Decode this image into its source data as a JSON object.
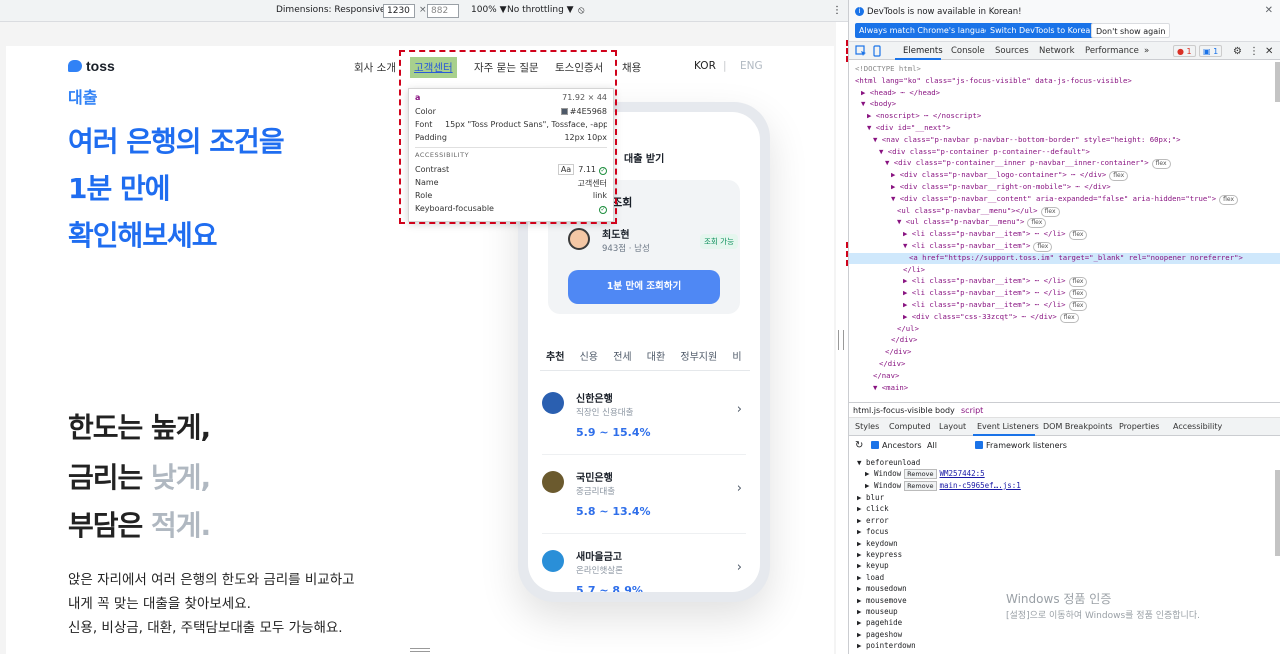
{
  "emulation": {
    "dimensions_label": "Dimensions: Responsive ▼",
    "width": "1230",
    "height": "882",
    "zoom": "100% ▼",
    "throttle": "No throttling ▼",
    "times": "×"
  },
  "site": {
    "logo_text": "toss",
    "nav": [
      "회사 소개",
      "고객센터",
      "자주 묻는 질문",
      "토스인증서",
      "채용"
    ],
    "lang_kor": "KOR",
    "lang_divider": "|",
    "lang_eng": "ENG",
    "hero_tag": "대출",
    "hero_lines": [
      "여러 은행의 조건을",
      "1분 만에",
      "확인해보세요"
    ],
    "feature_lines": [
      {
        "a": "한도는 높게,",
        "b": ""
      },
      {
        "a": "금리는 ",
        "b": "낮게,"
      },
      {
        "a": "부담은 ",
        "b": "적게."
      }
    ],
    "desc_lines": [
      "앉은 자리에서 여러 은행의 한도와 금리를 비교하고",
      "내게 꼭 맞는 대출을 찾아보세요.",
      "신용, 비상금, 대환, 주택담보대출 모두 가능해요."
    ]
  },
  "phone": {
    "title": "대출 받기",
    "card_title": "출조회",
    "user_name": "최도현",
    "user_sub": "943점 · 남성",
    "badge": "조회 가능",
    "button": "1분 만에 조회하기",
    "tabs": [
      "추천",
      "신용",
      "전세",
      "대환",
      "정부지원",
      "비"
    ],
    "banks": [
      {
        "name": "신한은행",
        "product": "직장인 신용대출",
        "rate": "5.9 ~ 15.4%",
        "color": "#2a5fb0"
      },
      {
        "name": "국민은행",
        "product": "중금리대출",
        "rate": "5.8 ~ 13.4%",
        "color": "#6b5a2e"
      },
      {
        "name": "새마을금고",
        "product": "온라인햇살론",
        "rate": "5.7 ~ 8.9%",
        "color": "#2a8fd8"
      }
    ]
  },
  "tooltip": {
    "tag": "a",
    "size": "71.92 × 44",
    "rows": [
      {
        "k": "Color",
        "v": "#4E5968"
      },
      {
        "k": "Font",
        "v": "15px \"Toss Product Sans\", Tossface, -appl…"
      },
      {
        "k": "Padding",
        "v": "12px 10px"
      }
    ],
    "section": "ACCESSIBILITY",
    "a11y": [
      {
        "k": "Contrast",
        "v": "7.11"
      },
      {
        "k": "Name",
        "v": "고객센터"
      },
      {
        "k": "Role",
        "v": "link"
      },
      {
        "k": "Keyboard-focusable",
        "v": ""
      }
    ],
    "contrast_aa": "Aa"
  },
  "devtools": {
    "info": "DevTools is now available in Korean!",
    "btn_match": "Always match Chrome's language",
    "btn_switch": "Switch DevTools to Korean",
    "btn_dont": "Don't show again",
    "tabs": [
      "Elements",
      "Console",
      "Sources",
      "Network",
      "Performance",
      "»"
    ],
    "err_count": "1",
    "msg_count": "1",
    "dom": [
      {
        "i": 0,
        "t": "<!DOCTYPE html>",
        "kind": "comment"
      },
      {
        "i": 0,
        "t": "<html lang=\"ko\" class=\"js-focus-visible\" data-js-focus-visible>"
      },
      {
        "i": 1,
        "t": "▶ <head> ⋯ </head>"
      },
      {
        "i": 1,
        "t": "▼ <body>"
      },
      {
        "i": 2,
        "t": "▶ <noscript> ⋯ </noscript>"
      },
      {
        "i": 2,
        "t": "▼ <div id=\"__next\">"
      },
      {
        "i": 3,
        "t": "▼ <nav class=\"p-navbar p-navbar--bottom-border\" style=\"height: 60px;\">"
      },
      {
        "i": 4,
        "t": "▼ <div class=\"p-container p-container--default\">"
      },
      {
        "i": 5,
        "t": "▼ <div class=\"p-container__inner p-navbar__inner-container\">",
        "chip": "flex"
      },
      {
        "i": 6,
        "t": "▶ <div class=\"p-navbar__logo-container\"> ⋯ </div>",
        "chip": "flex"
      },
      {
        "i": 6,
        "t": "▶ <div class=\"p-navbar__right-on-mobile\"> ⋯ </div>"
      },
      {
        "i": 6,
        "t": "▼ <div class=\"p-navbar__content\" aria-expanded=\"false\" aria-hidden=\"true\">",
        "chip": "flex"
      },
      {
        "i": 7,
        "t": "<ul class=\"p-navbar__menu\"></ul>",
        "chip": "flex"
      },
      {
        "i": 7,
        "t": "▼ <ul class=\"p-navbar__menu\">",
        "chip": "flex"
      },
      {
        "i": 8,
        "t": "▶ <li class=\"p-navbar__item\"> ⋯ </li>",
        "chip": "flex"
      },
      {
        "i": 8,
        "t": "▼ <li class=\"p-navbar__item\">",
        "chip": "flex"
      },
      {
        "i": 9,
        "t": "<a href=\"https://support.toss.im\" target=\"_blank\" rel=\"noopener noreferrer\">",
        "sel": true
      },
      {
        "i": 8,
        "t": "</li>"
      },
      {
        "i": 8,
        "t": "▶ <li class=\"p-navbar__item\"> ⋯ </li>",
        "chip": "flex"
      },
      {
        "i": 8,
        "t": "▶ <li class=\"p-navbar__item\"> ⋯ </li>",
        "chip": "flex"
      },
      {
        "i": 8,
        "t": "▶ <li class=\"p-navbar__item\"> ⋯ </li>",
        "chip": "flex"
      },
      {
        "i": 8,
        "t": "▶ <div class=\"css-33zcqt\"> ⋯ </div>",
        "chip": "flex"
      },
      {
        "i": 7,
        "t": "</ul>"
      },
      {
        "i": 6,
        "t": "</div>"
      },
      {
        "i": 5,
        "t": "</div>"
      },
      {
        "i": 4,
        "t": "</div>"
      },
      {
        "i": 3,
        "t": "</nav>"
      },
      {
        "i": 3,
        "t": "▼ <main>"
      }
    ],
    "crumbs": [
      "html.js-focus-visible",
      "body",
      "script"
    ],
    "sub_tabs": [
      "Styles",
      "Computed",
      "Layout",
      "Event Listeners",
      "DOM Breakpoints",
      "Properties",
      "Accessibility"
    ],
    "ancestors": "Ancestors",
    "all": "All",
    "framework": "Framework listeners",
    "events_open": "▼ beforeunload",
    "window_rows": [
      {
        "w": "▶ Window",
        "rm": "Remove",
        "src": "WM257442:5"
      },
      {
        "w": "▶ Window",
        "rm": "Remove",
        "src": "main-c5965ef….js:1"
      }
    ],
    "events": [
      "blur",
      "click",
      "error",
      "focus",
      "keydown",
      "keypress",
      "keyup",
      "load",
      "mousedown",
      "mousemove",
      "mouseup",
      "pagehide",
      "pageshow",
      "pointerdown"
    ]
  },
  "windows": {
    "line1": "Windows 정품 인증",
    "line2": "[설정]으로 이동하여 Windows를 정품 인증합니다."
  }
}
